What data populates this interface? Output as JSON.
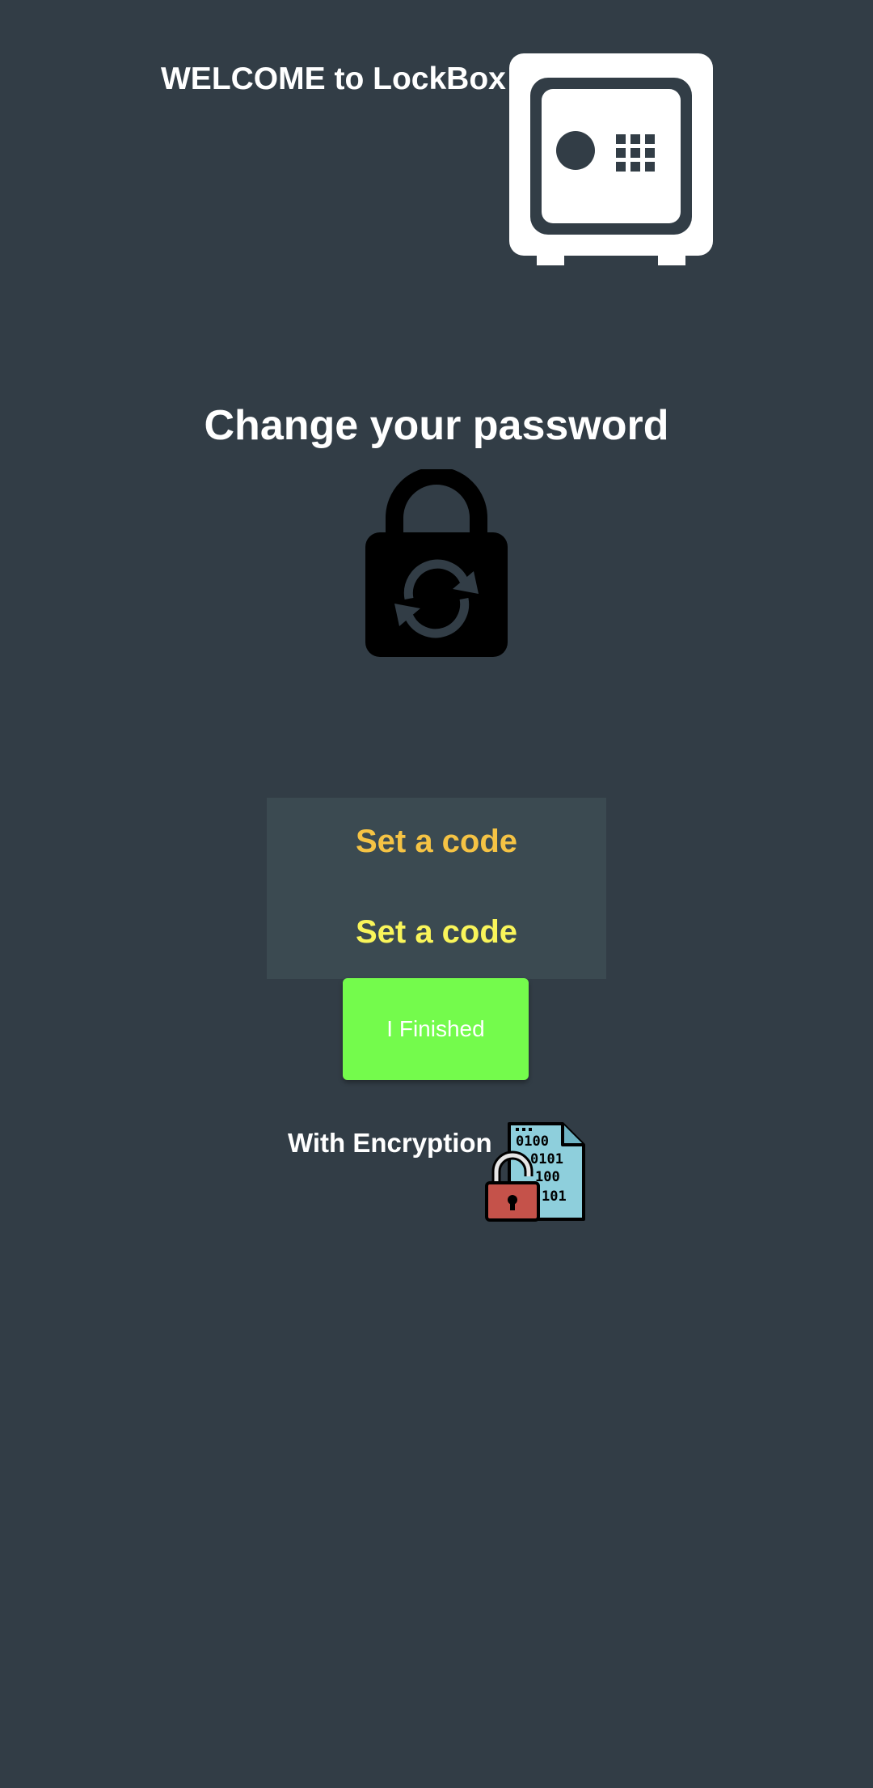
{
  "header": {
    "welcome_text": "WELCOME to LockBox",
    "logo_icon": "safe-icon"
  },
  "main": {
    "title": "Change your password",
    "title_icon": "lock-refresh-icon",
    "code_fields": [
      {
        "placeholder": "Set a code"
      },
      {
        "placeholder": "Set a code"
      }
    ],
    "finish_button_label": "I Finished",
    "encryption_label": "With Encryption",
    "encryption_icon": "encrypted-file-unlock-icon"
  },
  "colors": {
    "background": "#323d46",
    "panel": "#3b4a51",
    "first_field_text": "#f5c344",
    "second_field_text": "#f9f55a",
    "button": "#74fb4c"
  }
}
